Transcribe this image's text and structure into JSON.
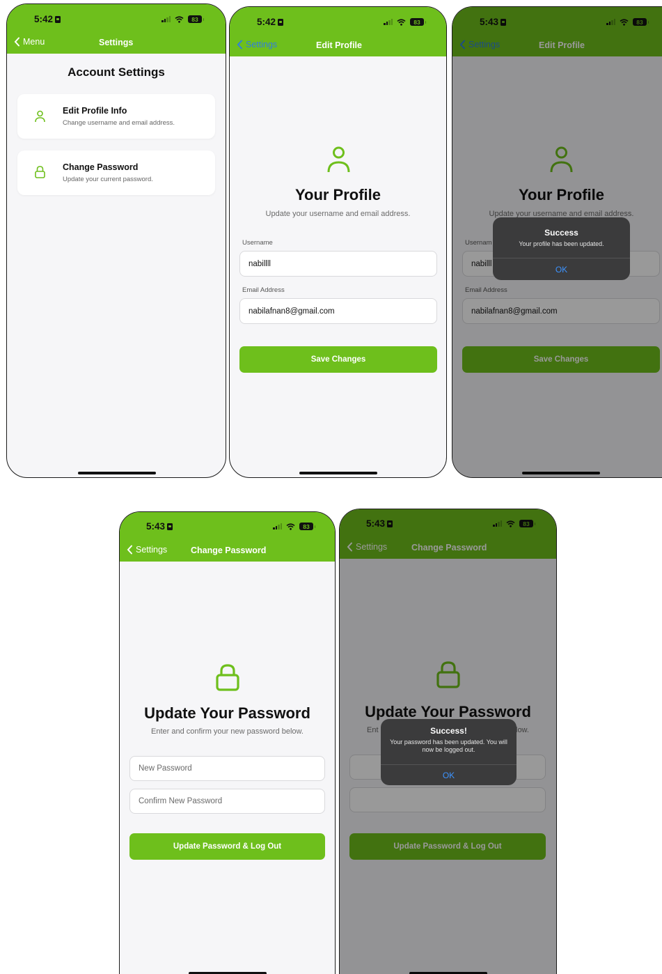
{
  "status": {
    "time_1": "5:42",
    "time_2": "5:42",
    "time_3": "5:43",
    "time_4": "5:43",
    "time_5": "5:43",
    "battery": "83"
  },
  "screen_settings": {
    "back_label": "Menu",
    "title": "Settings",
    "heading": "Account Settings",
    "items": [
      {
        "title": "Edit Profile Info",
        "subtitle": "Change username and email address.",
        "icon": "user-icon"
      },
      {
        "title": "Change Password",
        "subtitle": "Update your current password.",
        "icon": "lock-icon"
      }
    ]
  },
  "screen_edit_profile": {
    "back_label": "Settings",
    "title": "Edit Profile",
    "heading": "Your Profile",
    "subtitle": "Update your username and email address.",
    "username_label": "Username",
    "username_value": "nabillll",
    "email_label": "Email Address",
    "email_value": "nabilafnan8@gmail.com",
    "save_label": "Save Changes"
  },
  "screen_edit_profile_success": {
    "back_label": "Settings",
    "title": "Edit Profile",
    "heading": "Your Profile",
    "subtitle": "Update your username and email address.",
    "username_label": "Usernam",
    "username_value": "nabilll",
    "email_label": "Email Address",
    "email_value": "nabilafnan8@gmail.com",
    "save_label": "Save Changes",
    "alert_title": "Success",
    "alert_message": "Your profile has been updated.",
    "alert_ok": "OK"
  },
  "screen_change_password": {
    "back_label": "Settings",
    "title": "Change Password",
    "heading": "Update Your Password",
    "subtitle": "Enter and confirm your new password below.",
    "new_password_placeholder": "New Password",
    "confirm_password_placeholder": "Confirm New Password",
    "button_label": "Update Password & Log Out"
  },
  "screen_change_password_success": {
    "back_label": "Settings",
    "title": "Change Password",
    "heading": "Update Your Password",
    "sub_left": "Ent",
    "sub_right": "low.",
    "button_label": "Update Password & Log Out",
    "alert_title": "Success!",
    "alert_message": "Your password has been updated. You will now be logged out.",
    "alert_ok": "OK"
  },
  "colors": {
    "brand_green": "#6ebf1c",
    "link_blue": "#2f7de0",
    "alert_ok_blue": "#3d94ff",
    "background": "#f6f6f8"
  }
}
